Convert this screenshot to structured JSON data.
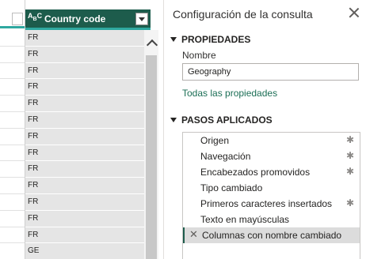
{
  "grid": {
    "column": {
      "type_icon": "ABC",
      "title": "Country code",
      "values": [
        "FR",
        "FR",
        "FR",
        "FR",
        "FR",
        "FR",
        "FR",
        "FR",
        "FR",
        "FR",
        "FR",
        "FR",
        "FR",
        "GE"
      ]
    }
  },
  "settings": {
    "title": "Configuración de la consulta",
    "properties": {
      "heading": "PROPIEDADES",
      "name_label": "Nombre",
      "name_value": "Geography",
      "all_properties_link": "Todas las propiedades"
    },
    "applied_steps": {
      "heading": "PASOS APLICADOS",
      "steps": [
        {
          "label": "Origen",
          "gear": true
        },
        {
          "label": "Navegación",
          "gear": true
        },
        {
          "label": "Encabezados promovidos",
          "gear": true
        },
        {
          "label": "Tipo cambiado",
          "gear": false
        },
        {
          "label": "Primeros caracteres insertados",
          "gear": true
        },
        {
          "label": "Texto en mayúsculas",
          "gear": false
        },
        {
          "label": "Columnas con nombre cambiado",
          "gear": false,
          "selected": true
        }
      ]
    }
  },
  "colors": {
    "header_bg": "#1d5c4c",
    "quality_bar": "#2fa8a0",
    "link": "#1b6e55"
  }
}
